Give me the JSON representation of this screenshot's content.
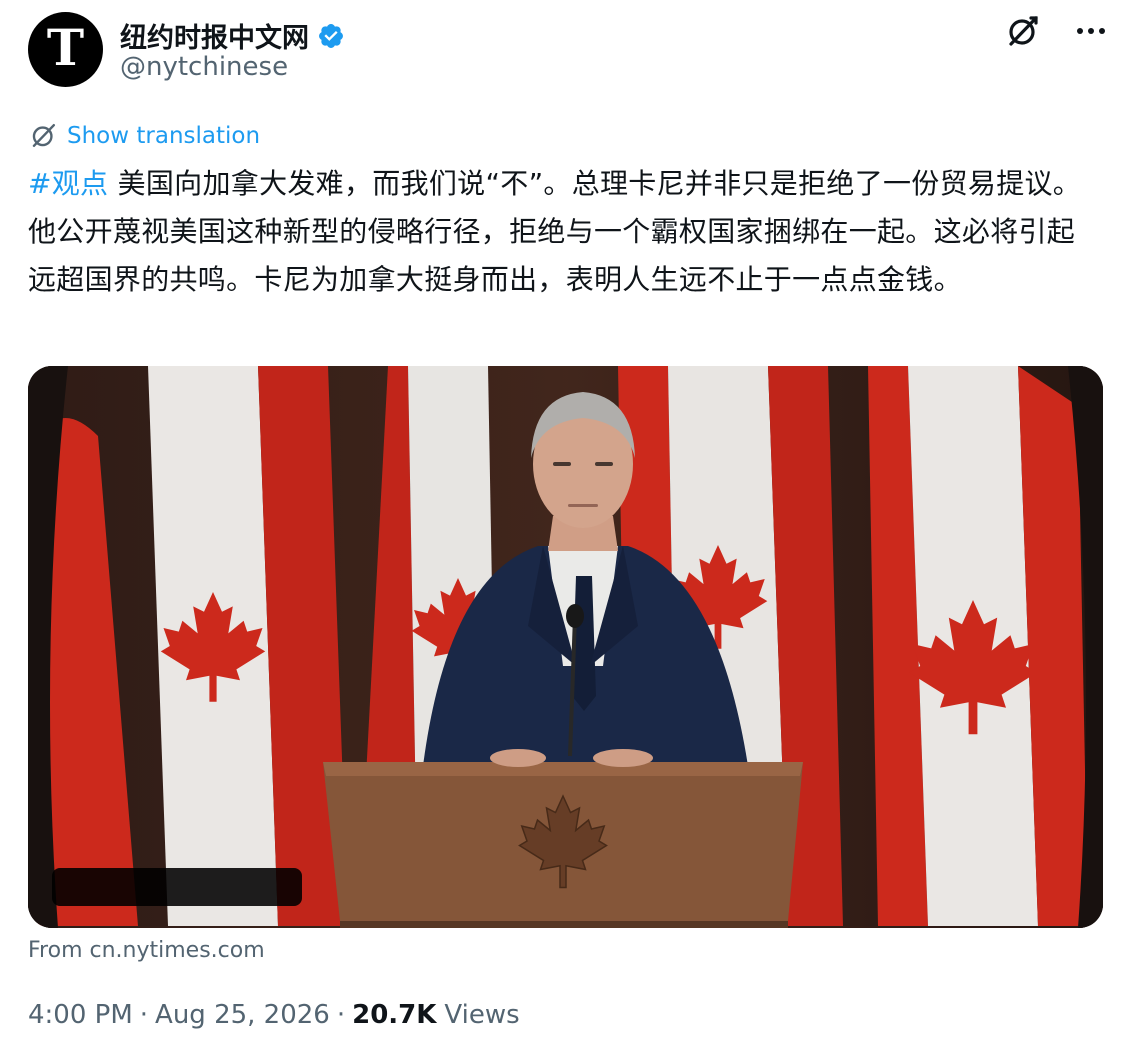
{
  "account": {
    "display_name": "纽约时报中文网",
    "handle": "@nytchinese",
    "avatar_glyph": "T",
    "verified": true
  },
  "translate": {
    "label": "Show translation"
  },
  "tweet": {
    "hashtag": "#观点",
    "body": " 美国向加拿大发难，而我们说“不”。总理卡尼并非只是拒绝了一份贸易提议。他公开蔑视美国这种新型的侵略行径，拒绝与一个霸权国家捆绑在一起。这必将引起远超国界的共鸣。卡尼为加拿大挺身而出，表明人生远不止于一点点金钱。"
  },
  "media": {
    "source": "From cn.nytimes.com"
  },
  "meta": {
    "time": "4:00 PM",
    "date": "Aug 25, 2026",
    "separator": "·",
    "views_count": "20.7K",
    "views_label": "Views"
  },
  "colors": {
    "accent": "#1d9bf0",
    "secondary_text": "#536471",
    "primary_text": "#0f1419",
    "flag_red": "#d52b1e"
  },
  "icons": [
    "verified-badge-icon",
    "grok-icon",
    "more-icon",
    "translate-icon"
  ]
}
